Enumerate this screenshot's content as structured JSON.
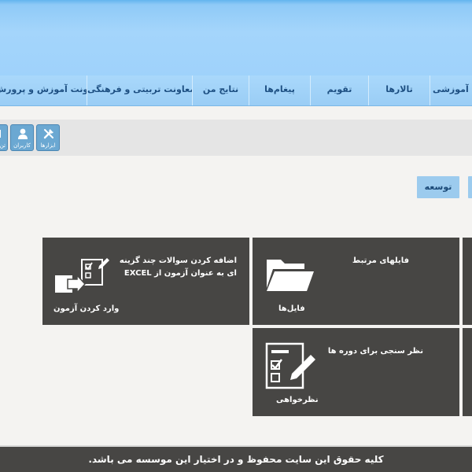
{
  "nav": {
    "items": [
      {
        "label": "معاونت آموزش و پرورش"
      },
      {
        "label": "معاونت تربیتی و فرهنگی"
      },
      {
        "label": "نتایج من"
      },
      {
        "label": "پیغام‌ها"
      },
      {
        "label": "تقویم"
      },
      {
        "label": "تالارها"
      },
      {
        "label": "مه آموزشی"
      }
    ]
  },
  "toolbar": {
    "tools": [
      {
        "label": "ابزارها",
        "icon": "tools-icon"
      },
      {
        "label": "کاربران",
        "icon": "users-icon"
      },
      {
        "label": "تن",
        "icon": "partial-icon"
      }
    ]
  },
  "tags": {
    "develop_label": "توسعه"
  },
  "tiles": {
    "exam": {
      "title": "اضافه کردن سوالات چند گزینه ای به عنوان آزمون از EXCEL",
      "name": "وارد کردن آزمون"
    },
    "files": {
      "title": "فایلهای مرتبط",
      "name": "فایل‌ها"
    },
    "survey": {
      "title": "نظر سنجی برای دوره ها",
      "name": "نظرخواهی"
    }
  },
  "footer": {
    "copyright": "کلیه حقوق این سایت محفوظ و در اختیار این موسسه می باشد."
  }
}
